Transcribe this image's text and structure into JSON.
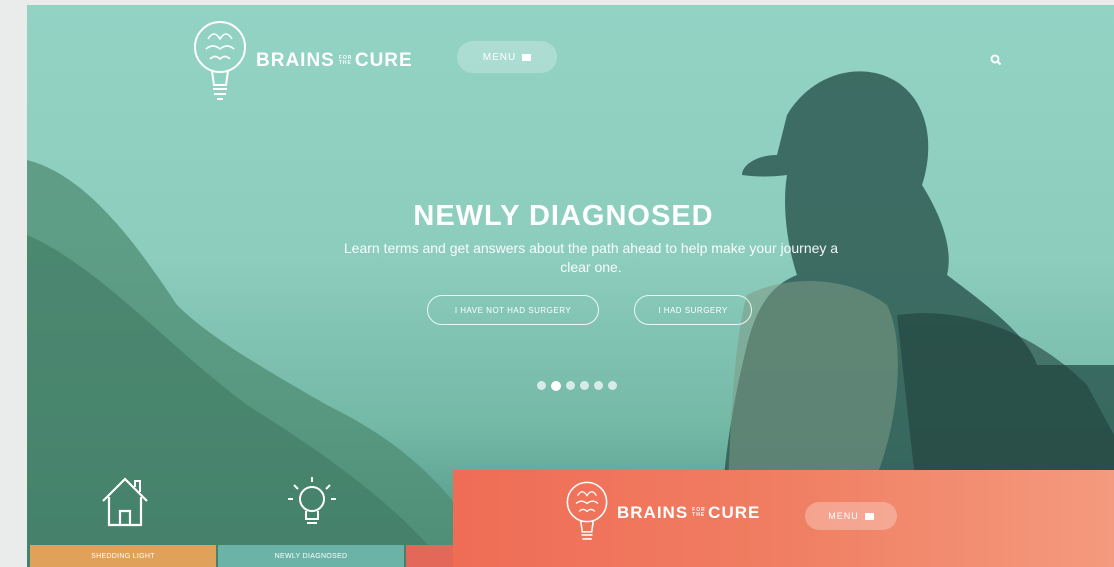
{
  "brand": {
    "name_left": "BRAINS",
    "name_small_top": "FOR",
    "name_small_bottom": "THE",
    "name_right": "CURE"
  },
  "header": {
    "menu_label": "MENU",
    "search_icon": "search-icon"
  },
  "hero": {
    "title": "NEWLY DIAGNOSED",
    "subtitle": "Learn terms and get answers about the path ahead to help make your journey a clear one.",
    "buttons": [
      {
        "label": "I HAVE NOT HAD SURGERY"
      },
      {
        "label": "I HAD SURGERY"
      }
    ],
    "carousel": {
      "count": 6,
      "active_index": 1
    }
  },
  "categories": [
    {
      "icon": "house-icon",
      "label": "SHEDDING LIGHT",
      "color": "#e0a25a"
    },
    {
      "icon": "lightbulb-icon",
      "label": "NEWLY DIAGNOSED",
      "color": "#6bb3a7"
    },
    {
      "icon": "",
      "label": "",
      "color": "#e4685a"
    }
  ],
  "overlay": {
    "menu_label": "MENU",
    "color": "#ef6c55"
  }
}
